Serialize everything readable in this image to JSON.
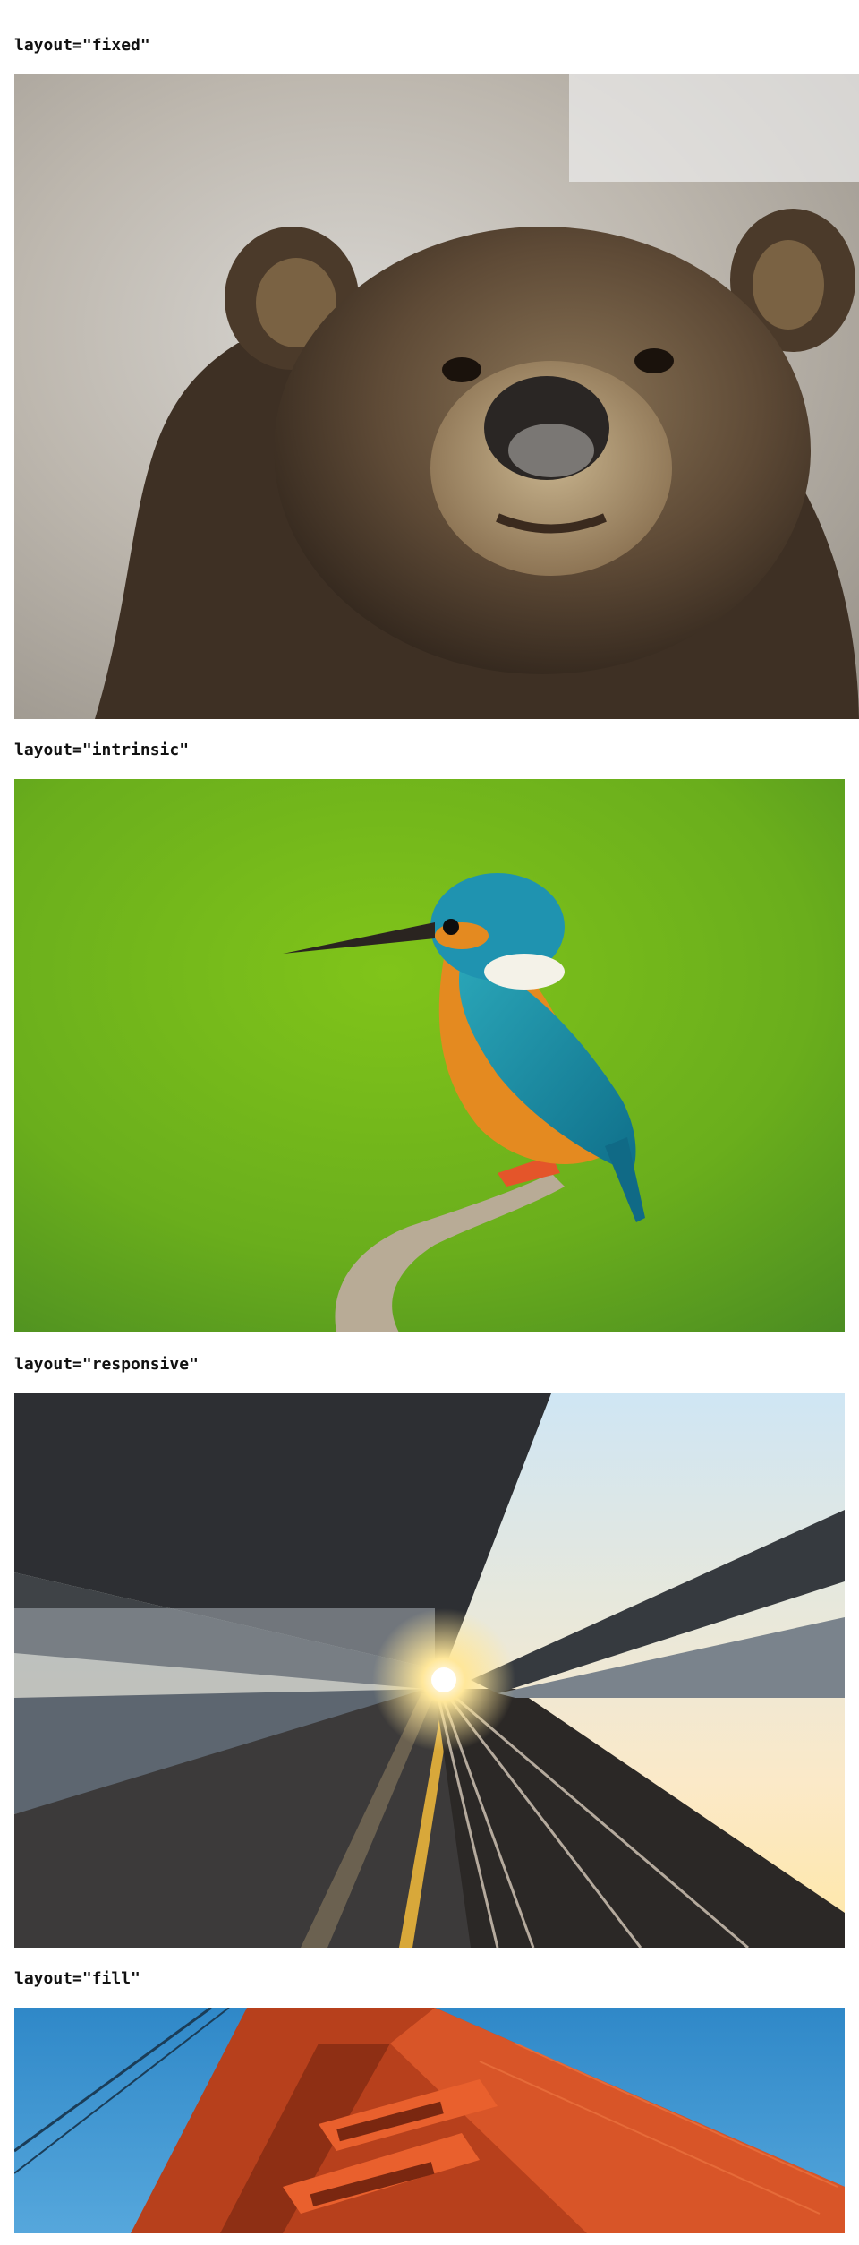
{
  "sections": [
    {
      "label": "layout=\"fixed\"",
      "image": "bear-photo"
    },
    {
      "label": "layout=\"intrinsic\"",
      "image": "kingfisher-photo"
    },
    {
      "label": "layout=\"responsive\"",
      "image": "train-platform-photo"
    },
    {
      "label": "layout=\"fill\"",
      "image": "golden-gate-bridge-photo"
    }
  ]
}
